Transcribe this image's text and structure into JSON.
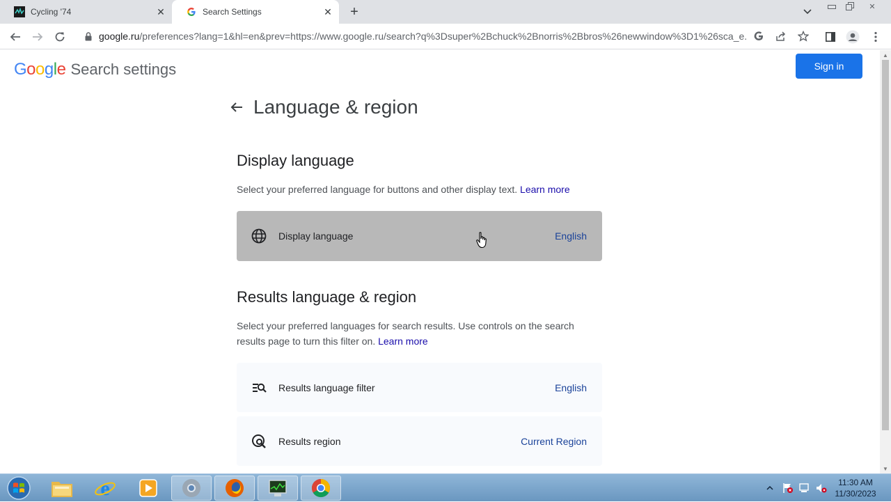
{
  "browser": {
    "tabs": [
      {
        "title": "Cycling '74",
        "active": false
      },
      {
        "title": "Search Settings",
        "active": true
      }
    ],
    "url_host": "google.ru",
    "url_rest": "/preferences?lang=1&hl=en&prev=https://www.google.ru/search?q%3Dsuper%2Bchuck%2Bnorris%2Bbros%26newwindow%3D1%26sca_e..."
  },
  "header": {
    "logo": [
      "G",
      "o",
      "o",
      "g",
      "l",
      "e"
    ],
    "logo_colors": [
      "#4285F4",
      "#EA4335",
      "#FBBC05",
      "#4285F4",
      "#34A853",
      "#EA4335"
    ],
    "settings_word": "Search settings",
    "signin_label": "Sign in"
  },
  "page": {
    "title": "Language & region",
    "display_section": {
      "heading": "Display language",
      "description": "Select your preferred language for buttons and other display text.",
      "learn_more": "Learn more",
      "row": {
        "label": "Display language",
        "value": "English",
        "icon": "globe-icon"
      }
    },
    "results_section": {
      "heading": "Results language & region",
      "description": "Select your preferred languages for search results. Use controls on the search results page to turn this filter on.",
      "learn_more": "Learn more",
      "rows": [
        {
          "label": "Results language filter",
          "value": "English",
          "icon": "filter-search-icon"
        },
        {
          "label": "Results region",
          "value": "Current Region",
          "icon": "region-search-icon"
        }
      ]
    }
  },
  "taskbar": {
    "apps": [
      "file-explorer-icon",
      "internet-explorer-icon",
      "media-player-icon",
      "chrome-alt-icon",
      "firefox-icon",
      "task-manager-icon",
      "chrome-icon"
    ],
    "time": "11:30 AM",
    "date": "11/30/2023"
  },
  "colors": {
    "accent": "#1a73e8",
    "link": "#1a0dab",
    "row_value": "#1a4299",
    "hover_row": "#b8b8b8"
  }
}
